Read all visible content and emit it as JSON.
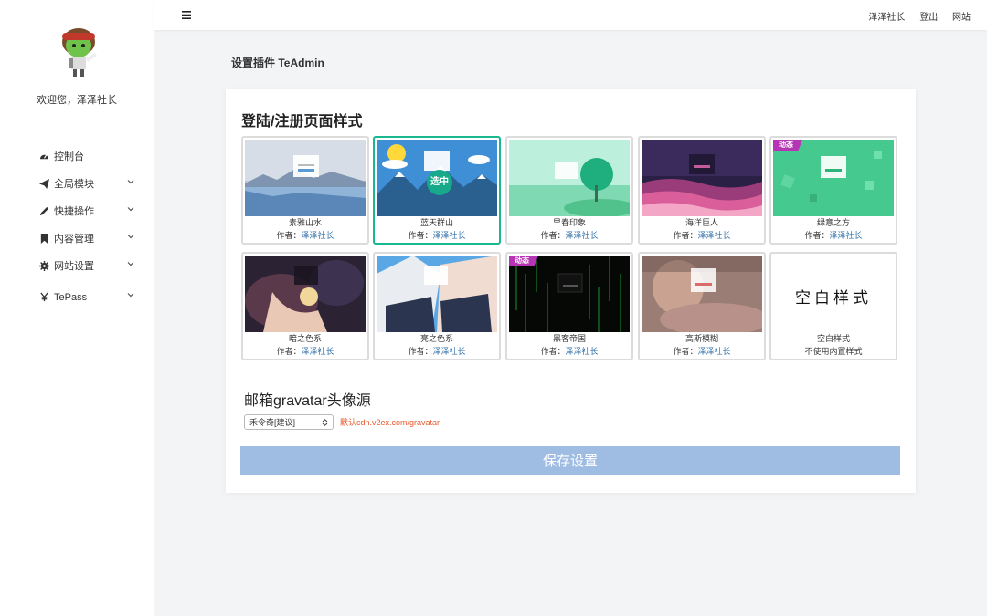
{
  "sidebar": {
    "welcome": "欢迎您，泽泽社长",
    "items": [
      {
        "label": "控制台",
        "icon": "dashboard-icon",
        "has_children": false
      },
      {
        "label": "全局模块",
        "icon": "paper-plane-icon",
        "has_children": true
      },
      {
        "label": "快捷操作",
        "icon": "pencil-icon",
        "has_children": true
      },
      {
        "label": "内容管理",
        "icon": "bookmark-icon",
        "has_children": true
      },
      {
        "label": "网站设置",
        "icon": "gear-icon",
        "has_children": true
      },
      {
        "label": "TePass",
        "icon": "yen-icon",
        "has_children": true
      }
    ]
  },
  "topbar": {
    "links": [
      "泽泽社长",
      "登出",
      "网站"
    ]
  },
  "page": {
    "title": "设置插件 TeAdmin"
  },
  "login_style": {
    "title": "登陆/注册页面样式",
    "selected_label": "选中",
    "author_prefix": "作者：",
    "badge_label": "动态",
    "styles": [
      {
        "name": "素雅山水",
        "author": "泽泽社长",
        "selected": false,
        "animated": false
      },
      {
        "name": "蓝天群山",
        "author": "泽泽社长",
        "selected": true,
        "animated": false
      },
      {
        "name": "早春印象",
        "author": "泽泽社长",
        "selected": false,
        "animated": false
      },
      {
        "name": "海洋巨人",
        "author": "泽泽社长",
        "selected": false,
        "animated": false
      },
      {
        "name": "绿意之方",
        "author": "泽泽社长",
        "selected": false,
        "animated": true
      },
      {
        "name": "暗之色系",
        "author": "泽泽社长",
        "selected": false,
        "animated": false
      },
      {
        "name": "亮之色系",
        "author": "泽泽社长",
        "selected": false,
        "animated": false
      },
      {
        "name": "黑客帝国",
        "author": "泽泽社长",
        "selected": false,
        "animated": true
      },
      {
        "name": "高斯模糊",
        "author": "泽泽社长",
        "selected": false,
        "animated": false
      },
      {
        "name": "空白样式",
        "author": "",
        "note": "不使用内置样式",
        "thumb_text": "空白样式",
        "selected": false,
        "animated": false
      }
    ]
  },
  "gravatar": {
    "title": "邮箱gravatar头像源",
    "selected": "禾令奇[建议]",
    "hint": "默认cdn.v2ex.com/gravatar"
  },
  "save_label": "保存设置",
  "colors": {
    "accent": "#19b890",
    "badge": "#b535b5",
    "link": "#2f6fa8",
    "hint": "#e65a2e",
    "button": "#9fbce2"
  }
}
